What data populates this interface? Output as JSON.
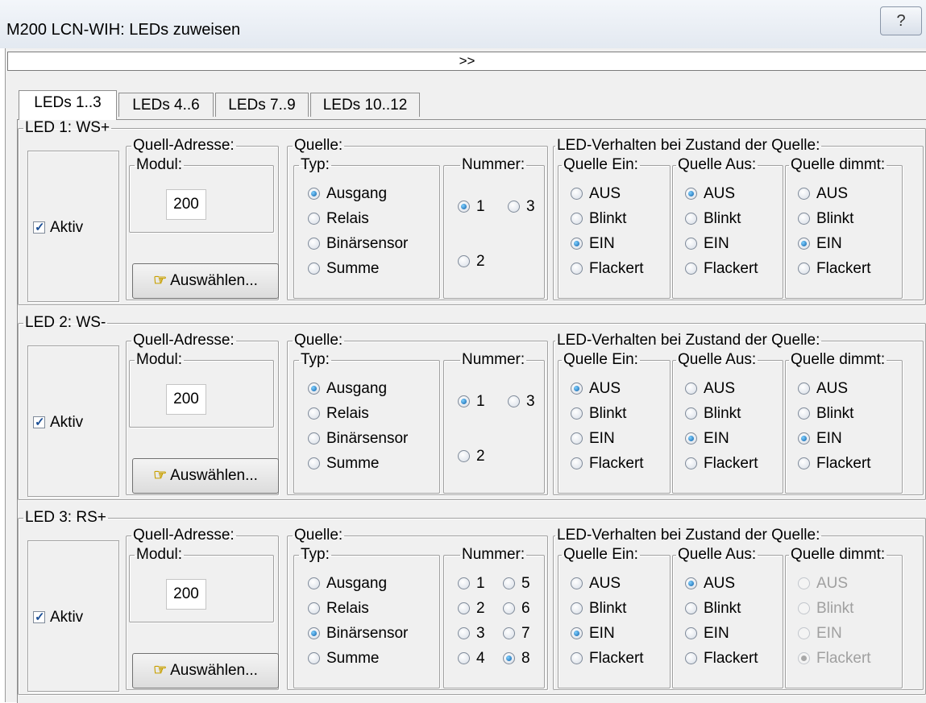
{
  "window": {
    "title": "M200 LCN-WIH: LEDs zuweisen",
    "help_button": "?",
    "expand_label": ">>"
  },
  "tabs": [
    {
      "label": "LEDs 1..3",
      "active": true
    },
    {
      "label": "LEDs 4..6",
      "active": false
    },
    {
      "label": "LEDs 7..9",
      "active": false
    },
    {
      "label": "LEDs 10..12",
      "active": false
    }
  ],
  "labels": {
    "quell_adresse": "Quell-Adresse:",
    "modul": "Modul:",
    "quelle": "Quelle:",
    "typ": "Typ:",
    "nummer": "Nummer:",
    "led_verhalten": "LED-Verhalten bei Zustand der Quelle:",
    "quelle_ein": "Quelle Ein:",
    "quelle_aus": "Quelle Aus:",
    "quelle_dimmt": "Quelle dimmt:",
    "aktiv": "Aktiv",
    "auswaehlen": "Auswählen...",
    "typ_options": [
      "Ausgang",
      "Relais",
      "Binärsensor",
      "Summe"
    ],
    "behavior_options": [
      "AUS",
      "Blinkt",
      "EIN",
      "Flackert"
    ]
  },
  "leds": [
    {
      "title": "LED 1: WS+",
      "aktiv": true,
      "modul": "200",
      "typ_selected": 0,
      "nummer_options": [
        "1",
        "3",
        "2"
      ],
      "nummer_selected": "1",
      "ein_selected": 2,
      "aus_selected": 0,
      "dimmt_selected": 2,
      "dimmt_disabled": false
    },
    {
      "title": "LED 2: WS-",
      "aktiv": true,
      "modul": "200",
      "typ_selected": 0,
      "nummer_options": [
        "1",
        "3",
        "2"
      ],
      "nummer_selected": "1",
      "ein_selected": 0,
      "aus_selected": 2,
      "dimmt_selected": 2,
      "dimmt_disabled": false
    },
    {
      "title": "LED 3: RS+",
      "aktiv": true,
      "modul": "200",
      "typ_selected": 2,
      "nummer_options": [
        "1",
        "5",
        "2",
        "6",
        "3",
        "7",
        "4",
        "8"
      ],
      "nummer_selected": "8",
      "ein_selected": 2,
      "aus_selected": 0,
      "dimmt_selected": 3,
      "dimmt_disabled": true
    }
  ]
}
